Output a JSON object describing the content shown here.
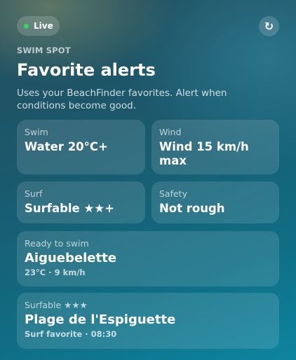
{
  "header": {
    "live_label": "Live",
    "refresh_icon_glyph": "↻",
    "eyebrow": "SWIM SPOT",
    "title": "Favorite alerts",
    "subtitle": "Uses your BeachFinder favorites. Alert when conditions become good."
  },
  "conditions": [
    {
      "label": "Swim",
      "value": "Water 20°C+"
    },
    {
      "label": "Wind",
      "value": "Wind 15 km/h max"
    },
    {
      "label": "Surf",
      "value": "Surfable ★★+"
    },
    {
      "label": "Safety",
      "value": "Not rough"
    }
  ],
  "alerts": [
    {
      "status": "Ready to swim",
      "spot": "Aiguebelette",
      "meta": "23°C · 9 km/h"
    },
    {
      "status": "Surfable ★★★",
      "spot": "Plage de l'Espiguette",
      "meta": "Surf favorite · 08:30"
    }
  ],
  "colors": {
    "live_dot": "#35d463",
    "background_top": "#234c5c",
    "background_bottom": "#0e85a0"
  }
}
